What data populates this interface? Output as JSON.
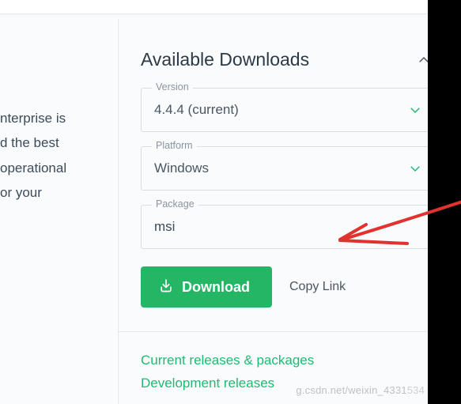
{
  "left_text": {
    "l1": "nterprise is",
    "l2": "d the best",
    "l3": "operational",
    "l4": "or your"
  },
  "section": {
    "title": "Available Downloads"
  },
  "fields": {
    "version": {
      "label": "Version",
      "value": "4.4.4 (current)"
    },
    "platform": {
      "label": "Platform",
      "value": "Windows"
    },
    "package": {
      "label": "Package",
      "value": "msi"
    }
  },
  "actions": {
    "download": "Download",
    "copy": "Copy Link"
  },
  "links": {
    "current": "Current releases & packages",
    "dev": "Development releases"
  },
  "watermark": {
    "left": "g.csdn.net/weixin_4331",
    "right": "534"
  }
}
